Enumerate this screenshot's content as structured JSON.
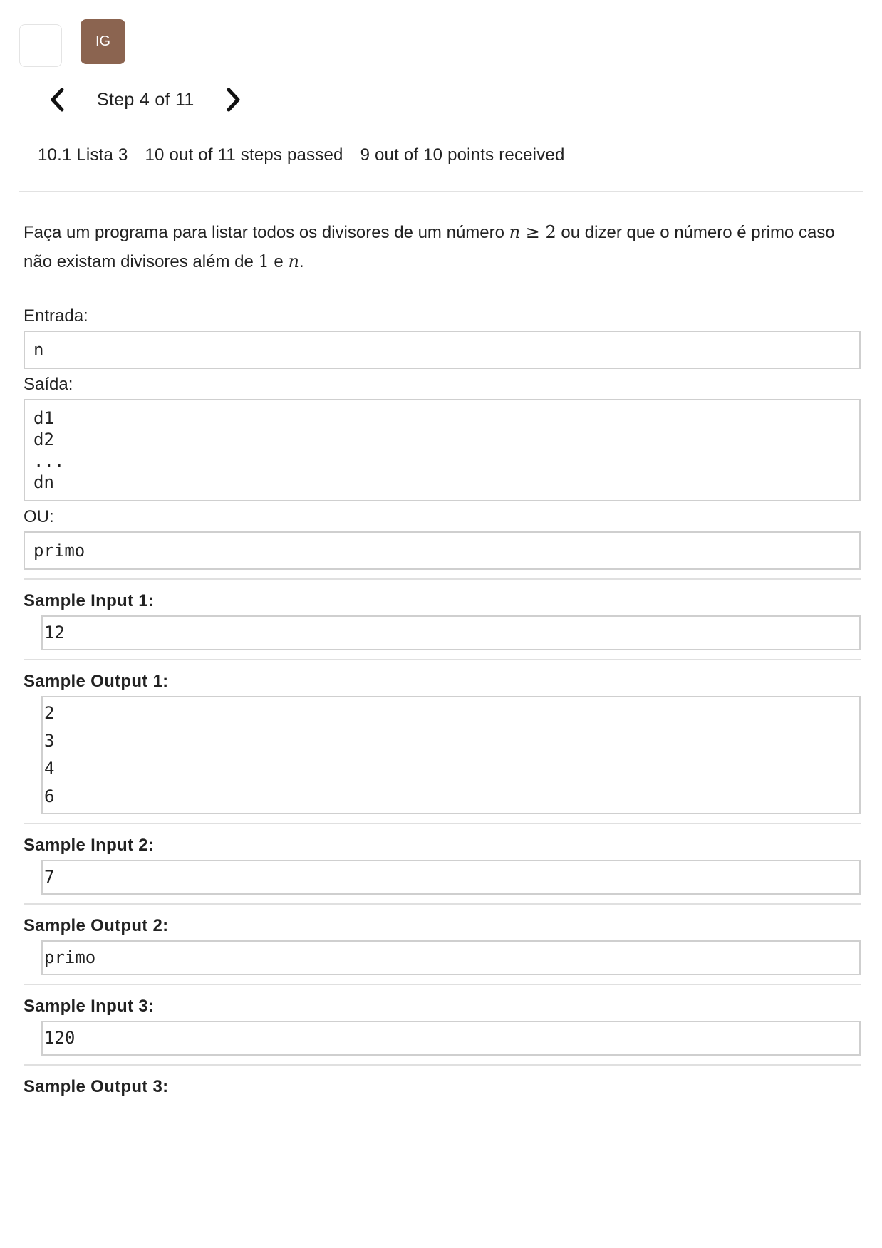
{
  "header": {
    "avatar_initials": "IG",
    "avatar_color": "#8b6450",
    "step_label": "Step 4 of 11",
    "prev_icon": "chevron-left-icon",
    "next_icon": "chevron-right-icon"
  },
  "progress": {
    "lesson": "10.1 Lista 3",
    "steps": "10 out of 11 steps passed",
    "points": "9 out of 10 points received"
  },
  "problem": {
    "text_before": "Faça um programa para listar todos os divisores de um número ",
    "math_n": "n",
    "math_geq": " ≥ ",
    "math_two": "2",
    "text_middle": " ou dizer que o número é primo caso não existam divisores além de ",
    "math_one": "1",
    "text_e": " e ",
    "math_n2": "n",
    "text_end": "."
  },
  "entrada": {
    "label": "Entrada:",
    "code": "n"
  },
  "saida": {
    "label": "Saída:",
    "code": "d1\nd2\n...\ndn"
  },
  "ou": {
    "label": "OU:",
    "code": "primo"
  },
  "samples": [
    {
      "title": "Sample Input 1:",
      "lines": [
        "12"
      ]
    },
    {
      "title": "Sample Output 1:",
      "lines": [
        "2",
        "3",
        "4",
        "6"
      ]
    },
    {
      "title": "Sample Input 2:",
      "lines": [
        "7"
      ]
    },
    {
      "title": "Sample Output 2:",
      "lines": [
        "primo"
      ]
    },
    {
      "title": "Sample Input 3:",
      "lines": [
        "120"
      ]
    },
    {
      "title": "Sample Output 3:",
      "lines": []
    }
  ]
}
